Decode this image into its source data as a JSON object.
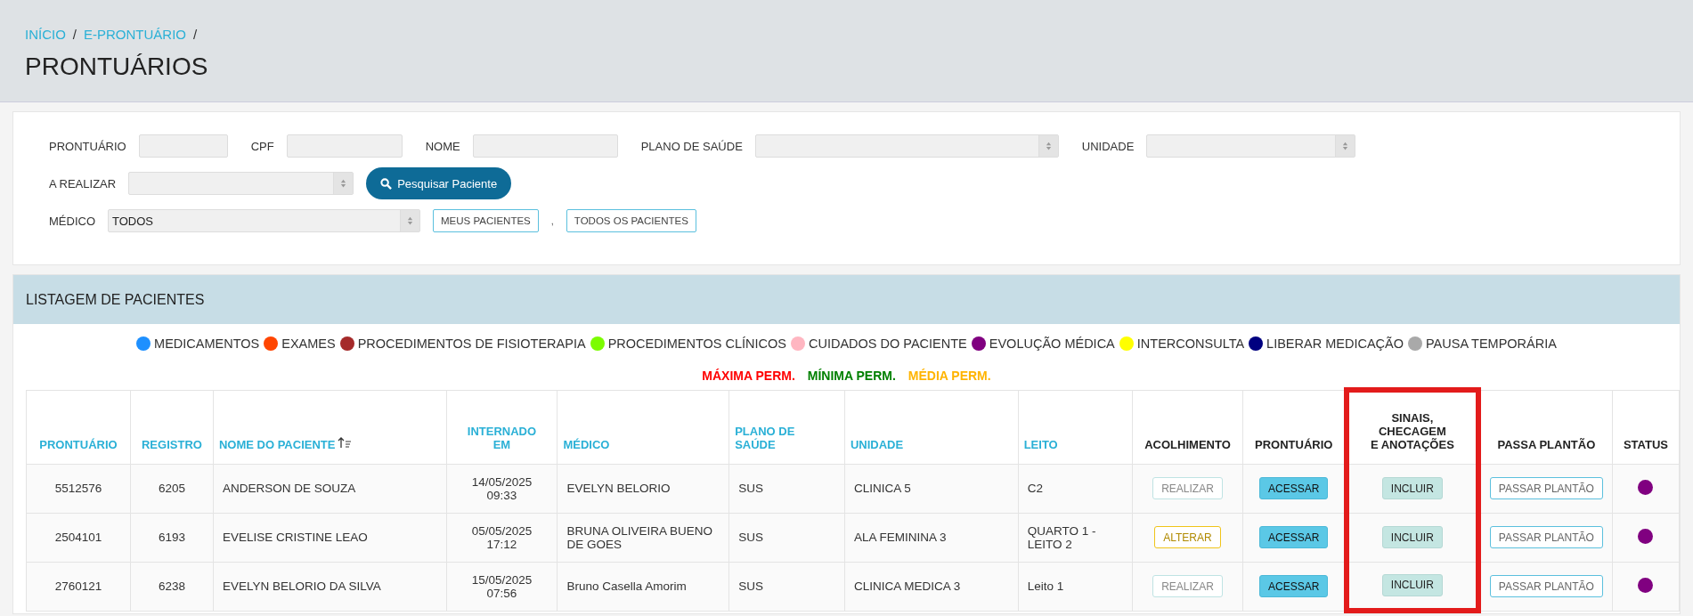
{
  "breadcrumb": [
    {
      "label": "INÍCIO",
      "separator": "/"
    },
    {
      "label": "E-PRONTUÁRIO",
      "separator": "/"
    }
  ],
  "page_title": "PRONTUÁRIOS",
  "filters": [
    [
      {
        "kind": "text",
        "label": "PRONTUÁRIO"
      },
      {
        "kind": "text",
        "label": "CPF"
      },
      {
        "kind": "text",
        "label": "NOME"
      },
      {
        "kind": "select",
        "label": "PLANO DE SAÚDE"
      },
      {
        "kind": "select",
        "label": "UNIDADE"
      }
    ],
    [
      {
        "kind": "select",
        "label": "A REALIZAR"
      },
      {
        "kind": "search",
        "label": "Pesquisar Paciente"
      }
    ],
    [
      {
        "kind": "select",
        "label": "MÉDICO",
        "value": "TODOS"
      },
      {
        "kind": "outline",
        "label": "MEUS PACIENTES"
      },
      {
        "kind": "separator",
        "label": ","
      },
      {
        "kind": "outline",
        "label": "TODOS OS PACIENTES"
      }
    ]
  ],
  "listing": {
    "title": "LISTAGEM DE PACIENTES",
    "legend": [
      {
        "label": "MEDICAMENTOS",
        "color": "#1e90ff"
      },
      {
        "label": "EXAMES",
        "color": "#ff4500"
      },
      {
        "label": "PROCEDIMENTOS DE FISIOTERAPIA",
        "color": "#a52a2a"
      },
      {
        "label": "PROCEDIMENTOS CLÍNICOS",
        "color": "#7cfc00"
      },
      {
        "label": "CUIDADOS DO PACIENTE",
        "color": "#ffb6c1"
      },
      {
        "label": "EVOLUÇÃO MÉDICA",
        "color": "#800080"
      },
      {
        "label": "INTERCONSULTA",
        "color": "#ffff00"
      },
      {
        "label": "LIBERAR MEDICAÇÃO",
        "color": "#000080"
      },
      {
        "label": "PAUSA TEMPORÁRIA",
        "color": "#a9a9a9"
      }
    ],
    "permanence": [
      {
        "label": "MÁXIMA PERM.",
        "color": "#ff0000"
      },
      {
        "label": "MÍNIMA PERM.",
        "color": "#008000"
      },
      {
        "label": "MÉDIA PERM.",
        "color": "#ffb400"
      }
    ],
    "columns": [
      {
        "label": "PRONTUÁRIO",
        "kind": "sortable"
      },
      {
        "label": "REGISTRO",
        "kind": "sortable"
      },
      {
        "label": "NOME DO PACIENTE",
        "kind": "sorted"
      },
      {
        "label": "INTERNADO\nEM",
        "kind": "sortable"
      },
      {
        "label": "MÉDICO",
        "kind": "sortable"
      },
      {
        "label": "PLANO DE\nSAÚDE",
        "kind": "sortable"
      },
      {
        "label": "UNIDADE",
        "kind": "sortable"
      },
      {
        "label": "LEITO",
        "kind": "sortable"
      },
      {
        "label": "ACOLHIMENTO",
        "kind": "plain"
      },
      {
        "label": "PRONTUÁRIO",
        "kind": "plain"
      },
      {
        "label": "SINAIS,\nCHECAGEM\nE ANOTAÇÕES",
        "kind": "plain",
        "highlighted": true
      },
      {
        "label": "PASSA PLANTÃO",
        "kind": "plain"
      },
      {
        "label": "STATUS",
        "kind": "plain"
      }
    ],
    "rows": [
      {
        "cells": [
          {
            "kind": "text",
            "text": "5512576"
          },
          {
            "kind": "text",
            "text": "6205"
          },
          {
            "kind": "text",
            "text": "ANDERSON DE SOUZA"
          },
          {
            "kind": "text",
            "text": "14/05/2025\n09:33"
          },
          {
            "kind": "text",
            "text": "EVELYN BELORIO"
          },
          {
            "kind": "text",
            "text": "SUS"
          },
          {
            "kind": "text",
            "text": "CLINICA 5"
          },
          {
            "kind": "text",
            "text": "C2"
          },
          {
            "kind": "realizar",
            "text": "REALIZAR"
          },
          {
            "kind": "acessar",
            "text": "ACESSAR"
          },
          {
            "kind": "incluir",
            "text": "INCLUIR"
          },
          {
            "kind": "passar",
            "text": "PASSAR PLANTÃO"
          },
          {
            "kind": "status",
            "color": "#800080"
          }
        ]
      },
      {
        "cells": [
          {
            "kind": "text",
            "text": "2504101"
          },
          {
            "kind": "text",
            "text": "6193"
          },
          {
            "kind": "text",
            "text": "EVELISE CRISTINE LEAO"
          },
          {
            "kind": "text",
            "text": "05/05/2025\n17:12"
          },
          {
            "kind": "text",
            "text": "BRUNA OLIVEIRA BUENO\nDE GOES"
          },
          {
            "kind": "text",
            "text": "SUS"
          },
          {
            "kind": "text",
            "text": "ALA FEMININA 3"
          },
          {
            "kind": "text",
            "text": "QUARTO 1 -\nLEITO 2"
          },
          {
            "kind": "alterar",
            "text": "ALTERAR"
          },
          {
            "kind": "acessar",
            "text": "ACESSAR"
          },
          {
            "kind": "incluir",
            "text": "INCLUIR"
          },
          {
            "kind": "passar",
            "text": "PASSAR PLANTÃO"
          },
          {
            "kind": "status",
            "color": "#800080"
          }
        ]
      },
      {
        "cells": [
          {
            "kind": "text",
            "text": "2760121"
          },
          {
            "kind": "text",
            "text": "6238"
          },
          {
            "kind": "text",
            "text": "EVELYN BELORIO DA SILVA"
          },
          {
            "kind": "text",
            "text": "15/05/2025\n07:56"
          },
          {
            "kind": "text",
            "text": "Bruno Casella Amorim"
          },
          {
            "kind": "text",
            "text": "SUS"
          },
          {
            "kind": "text",
            "text": "CLINICA MEDICA 3"
          },
          {
            "kind": "text",
            "text": "Leito 1"
          },
          {
            "kind": "realizar",
            "text": "REALIZAR"
          },
          {
            "kind": "acessar",
            "text": "ACESSAR"
          },
          {
            "kind": "incluir",
            "text": "INCLUIR"
          },
          {
            "kind": "passar",
            "text": "PASSAR PLANTÃO"
          },
          {
            "kind": "status",
            "color": "#800080"
          }
        ]
      }
    ]
  }
}
